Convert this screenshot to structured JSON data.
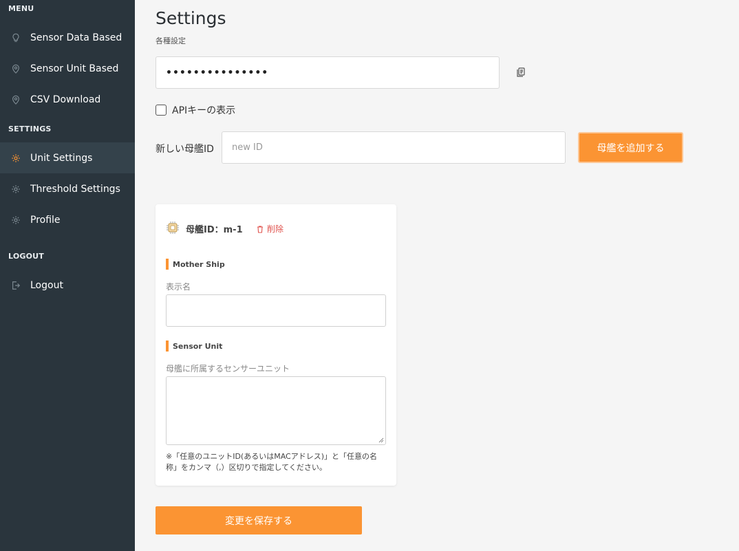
{
  "sidebar": {
    "menu_label": "MENU",
    "settings_label": "SETTINGS",
    "logout_label": "LOGOUT",
    "menu_items": [
      {
        "label": "Sensor Data Based",
        "icon": "lightbulb-icon"
      },
      {
        "label": "Sensor Unit Based",
        "icon": "location-pin-icon"
      },
      {
        "label": "CSV Download",
        "icon": "location-pin-icon"
      }
    ],
    "settings_items": [
      {
        "label": "Unit Settings",
        "icon": "gear-icon",
        "active": true
      },
      {
        "label": "Threshold Settings",
        "icon": "gear-icon",
        "active": false
      },
      {
        "label": "Profile",
        "icon": "gear-icon",
        "active": false
      }
    ],
    "logout_item": {
      "label": "Logout",
      "icon": "logout-icon"
    }
  },
  "header": {
    "title": "Settings",
    "subtitle": "各種設定"
  },
  "api_key": {
    "value": "•••••••••••••••",
    "show_label": "APIキーの表示",
    "show_checked": false
  },
  "new_id": {
    "label": "新しい母艦ID",
    "placeholder": "new ID",
    "value": "",
    "add_button": "母艦を追加する"
  },
  "mothership_card": {
    "title": "母艦ID：m-1",
    "delete_label": "削除",
    "mother_ship_section": "Mother Ship",
    "display_name_label": "表示名",
    "display_name_value": "",
    "sensor_unit_section": "Sensor Unit",
    "sensor_units_label": "母艦に所属するセンサーユニット",
    "sensor_units_value": "",
    "note": "※「任意のユニットID(あるいはMACアドレス)」と「任意の名称」をカンマ（,）区切りで指定してください。"
  },
  "save_button": "変更を保存する",
  "colors": {
    "sidebar_bg": "#2a353d",
    "sidebar_active": "#34424b",
    "accent": "#fb9433",
    "active_icon": "#fb9433",
    "delete": "#e0534e"
  }
}
